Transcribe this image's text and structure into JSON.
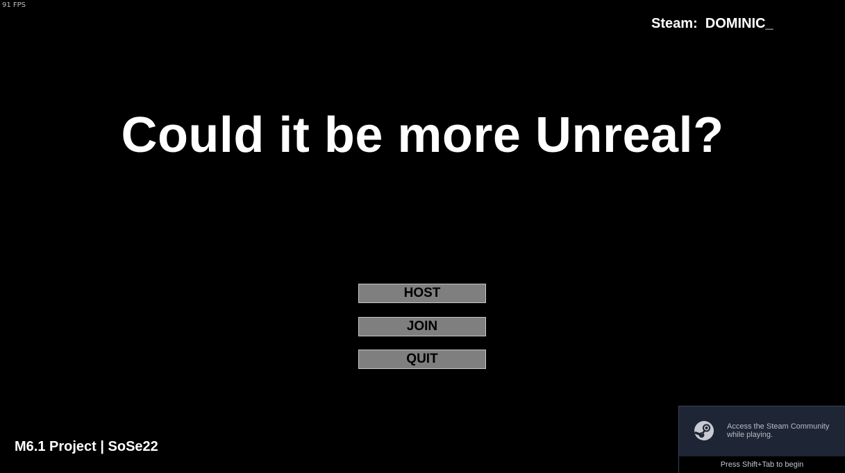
{
  "hud": {
    "fps": "91 FPS",
    "steam_user": "Steam:  DOMINIC_"
  },
  "title": "Could it be more Unreal?",
  "menu": {
    "host_label": "HOST",
    "join_label": "JOIN",
    "quit_label": "QUIT"
  },
  "footer": {
    "project": "M6.1 Project | SoSe22"
  },
  "steam_overlay": {
    "message": "Access the Steam Community while playing.",
    "hint": "Press Shift+Tab to begin",
    "icon": "steam-logo-icon"
  },
  "colors": {
    "background": "#000000",
    "button_fill": "#7f7f7f",
    "button_border": "#c8c8c8",
    "overlay_bg": "#1e2534"
  }
}
